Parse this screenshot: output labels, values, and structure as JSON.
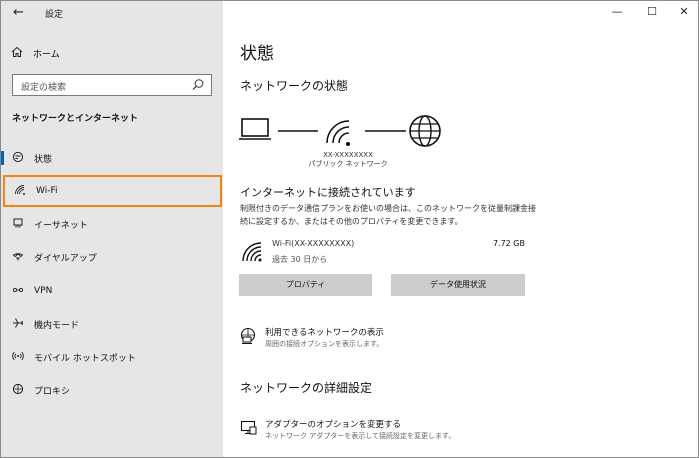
{
  "app": {
    "title": "設定",
    "back_glyph": "←"
  },
  "window_controls": {
    "minimize": "—",
    "maximize": "☐",
    "close": "✕"
  },
  "sidebar": {
    "home_label": "ホーム",
    "search_placeholder": "設定の検索",
    "section_label": "ネットワークとインターネット",
    "items": [
      {
        "label": "状態",
        "icon": "status-icon",
        "selected": true
      },
      {
        "label": "Wi-Fi",
        "icon": "wifi-icon",
        "highlighted": true
      },
      {
        "label": "イーサネット",
        "icon": "ethernet-icon"
      },
      {
        "label": "ダイヤルアップ",
        "icon": "dialup-icon"
      },
      {
        "label": "VPN",
        "icon": "vpn-icon"
      },
      {
        "label": "機内モード",
        "icon": "airplane-icon"
      },
      {
        "label": "モバイル ホットスポット",
        "icon": "hotspot-icon"
      },
      {
        "label": "プロキシ",
        "icon": "proxy-icon"
      }
    ]
  },
  "main": {
    "title": "状態",
    "network_status_heading": "ネットワークの状態",
    "network_ssid": "XX-XXXXXXXX",
    "network_type": "パブリック ネットワーク",
    "connected_heading": "インターネットに接続されています",
    "connected_desc": "制限付きのデータ通信プランをお使いの場合は、このネットワークを従量制課金接続に設定するか、またはその他のプロパティを変更できます。",
    "connection": {
      "name": "Wi-Fi(XX-XXXXXXXX)",
      "period": "過去 30 日から",
      "usage": "7.72 GB"
    },
    "buttons": {
      "properties": "プロパティ",
      "data_usage": "データ使用状況"
    },
    "available_networks": {
      "title": "利用できるネットワークの表示",
      "sub": "周囲の接続オプションを表示します。"
    },
    "advanced_heading": "ネットワークの詳細設定",
    "adapter_options": {
      "title": "アダプターのオプションを変更する",
      "sub": "ネットワーク アダプターを表示して接続設定を変更します。"
    }
  },
  "colors": {
    "accent": "#0063b1",
    "highlight_border": "#f0870f",
    "sidebar_bg": "#e6e6e6",
    "button_bg": "#cccccc"
  }
}
